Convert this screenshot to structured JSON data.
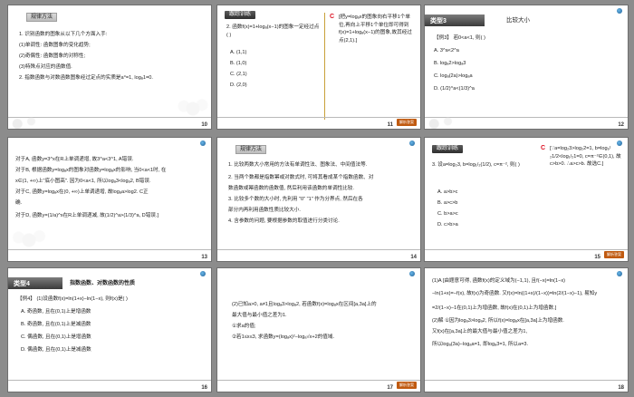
{
  "slides": [
    {
      "number": "10",
      "tag": "规律方法",
      "lines": [
        "1. 识别函数的图象从以下几个方面入手:",
        "(1)单调性: 函数图象的变化趋势;",
        "(2)奇偶性: 函数图象的对称性;",
        "(3)特殊点对应的函数值.",
        "2. 指数函数与对数函数图象经过定点的实质是a⁰=1, logₐ1=0."
      ]
    },
    {
      "number": "11",
      "tag": "跟踪训练",
      "answer_letter": "C",
      "question": "2. 函数f(x)=1+logₐ(x−1)的图象一定经过点(    )",
      "options": [
        "A. (1,1)",
        "B. (1,0)",
        "C. (2,1)",
        "D. (2,0)"
      ],
      "explanation": "[把y=logₐx的图象向右平移1个单位,再向上平移1个单位即可得到f(x)=1+logₐ(x−1)的图象,故其经过点(2,1).]",
      "button": "解析答案"
    },
    {
      "number": "12",
      "type_label": "类型3",
      "title": "比较大小",
      "lines": [
        "【例3】 若0<a<1, 则(    )",
        "A. 3^a<2^a",
        "B. logₐ2>logₐ3",
        "C. logₐ(2a)>logₐa",
        "D. (1/2)^a<(1/3)^a"
      ]
    },
    {
      "number": "13",
      "lines": [
        "对于A, 函数y=3^x在R上单调递增, 故3^a<3^1, A错误.",
        "对于B, 根据函数y=logₐx的图象对函数y=logₐx的影响, 当0<a<1时, 在",
        "x∈(1, +∞)上\"底小图高\". 因为0<a<1, 所以logₐ3<logₐ2, B错误.",
        "对于C, 函数y=logₐx在(0, +∞)上单调递增, 故logₐa>log2. C正",
        "确.",
        "对于D, 函数y=(1/a)^x在R上单调递减, 故(1/2)^a>(1/3)^a, D错误.]"
      ]
    },
    {
      "number": "14",
      "tag": "规律方法",
      "lines": [
        "1. 比较两数大小常用的方法有单调性法、图象法、中间值法等.",
        "2. 当两个数都是指数幂或对数式时, 可将其看成某个指数函数、对",
        "数函数或幂函数的函数值, 然后利用该函数的单调性比较.",
        "3. 比较多个数的大小时, 先利用 \"0\" \"1\" 作为分界点, 然后在各",
        "部分内再利用函数性质比较大小.",
        "4. 含参数的问题, 要根据参数的取值进行分类讨论."
      ]
    },
    {
      "number": "15",
      "tag": "跟踪训练",
      "answer_letter": "C",
      "explanation": "[∵a=log₂3>log₂2=1, b=log₁/₂1/2<log₁/₂1=0, c=π⁻²∈(0,1), 故c>b>0. ∴a>c>b. 故选C.]",
      "question": "3. 设a=log₂3, b=log₁/₂(1/2), c=π⁻², 则(    )",
      "options": [
        "A. a>b>c",
        "B. a>c>b",
        "C. b>a>c",
        "D. c>b>a"
      ],
      "button": "解析答案"
    },
    {
      "number": "16",
      "type_label": "类型4",
      "title": "指数函数、对数函数的性质",
      "lines": [
        "【例4】 (1)设函数f(x)=ln(1+x)−ln(1−x), 则f(x)是(    )",
        "A. 奇函数, 且在(0,1)上是增函数",
        "B. 奇函数, 且在(0,1)上是减函数",
        "C. 偶函数, 且在(0,1)上是增函数",
        "D. 偶函数, 且在(0,1)上是减函数"
      ]
    },
    {
      "number": "17",
      "lines": [
        "(2)已知a>0, a≠1且logₐ3>logₐ2, 若函数f(x)=logₐx在区间[a,3a]上的",
        "最大值与最小值之差为1.",
        "①求a的值;",
        "②若1≤x≤3, 求函数y=(logₐx)²−logₐ√x+2的值域."
      ],
      "button": "解析答案"
    },
    {
      "number": "18",
      "lines": [
        "(1)A  [由题意可得, 函数f(x)的定义域为(−1,1), 且f(−x)=ln(1−x)",
        "−ln(1+x)=−f(x), 故f(x)为奇函数. 又f(x)=ln((1+x)/(1−x))=ln(2/(1−x)−1), 易知y",
        "=2/(1−x)−1在(0,1)上为增函数, 故f(x)在(0,1)上为增函数.]",
        "(2)解  ①因为logₐ3>logₐ2, 所以f(x)=logₐx在[a,3a]上为增函数.",
        "又f(x)在[a,3a]上的最大值与最小值之差为1,",
        "所以logₐ(3a)−logₐa=1, 即logₐ3=1, 所以a=3."
      ]
    }
  ],
  "colors": {
    "background": "#8c8c8c",
    "answer_red": "#dd1122",
    "button_orange": "#c05a10"
  }
}
